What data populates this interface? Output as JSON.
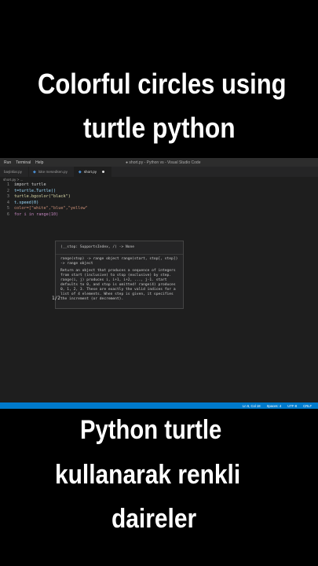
{
  "captions": {
    "top_line1": "Colorful circles using",
    "top_line2": "turtle python",
    "bottom_line1": "Python turtle",
    "bottom_line2": "kullanarak renkli",
    "bottom_line3": "daireler"
  },
  "vscode": {
    "menu": [
      "Run",
      "Terminal",
      "Help"
    ],
    "window_title": "● short.py - Python vs - Visual Studio Code",
    "tabs": [
      {
        "label": "başlıklar.py",
        "active": false
      },
      {
        "label": "lüke mesedken.py",
        "active": false
      },
      {
        "label": "short.py",
        "active": true
      }
    ],
    "breadcrumb": "short.py > ...",
    "code": [
      {
        "n": "1",
        "text": "import turtle"
      },
      {
        "n": "2",
        "text": "t=turtle.Turtle()"
      },
      {
        "n": "3",
        "text": "turtle.bgcolor(\"black\")"
      },
      {
        "n": "4",
        "text": "t.speed(0)"
      },
      {
        "n": "5",
        "text": "color=[\"white\",\"blue\",\"yellow\""
      },
      {
        "n": "6",
        "text": "for i in range(10)"
      }
    ],
    "hover": {
      "signature": "(__stop: SupportsIndex, /) -> None",
      "overloads": "range(stop) -> range object range(start, stop[, step]) -> range object",
      "description": "Return an object that produces a sequence of integers from start (inclusive) to stop (exclusive) by step. range(i, j) produces i, i+1, i+2, ..., j-1. start defaults to 0, and stop is omitted! range(4) produces 0, 1, 2, 3. These are exactly the valid indices for a list of 4 elements. When step is given, it specifies the increment (or decrement).",
      "counter": "1/2"
    },
    "status": [
      "Ln 6, Col 18",
      "Spaces: 4",
      "UTF-8",
      "CRLF"
    ]
  },
  "colors": {
    "background": "#000000",
    "editor_bg": "#1e1e1e",
    "statusbar": "#007acc"
  }
}
